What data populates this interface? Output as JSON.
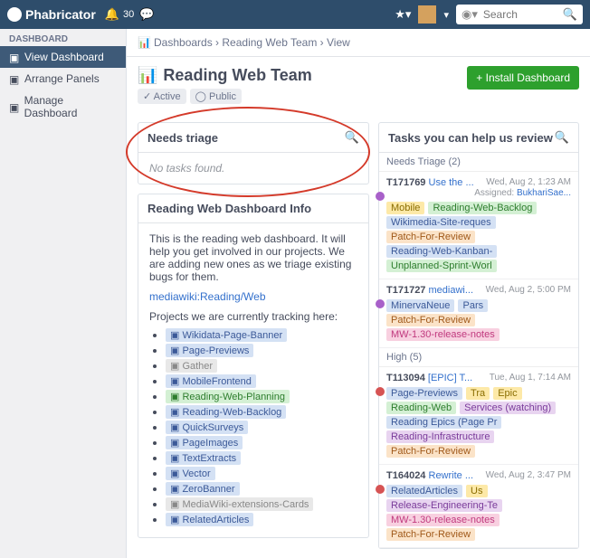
{
  "topbar": {
    "brand": "Phabricator",
    "notif_count": "30",
    "search_placeholder": "Search"
  },
  "sidebar": {
    "header": "DASHBOARD",
    "items": [
      {
        "label": "View Dashboard",
        "active": true
      },
      {
        "label": "Arrange Panels",
        "active": false
      },
      {
        "label": "Manage Dashboard",
        "active": false
      }
    ]
  },
  "breadcrumb": [
    "Dashboards",
    "Reading Web Team",
    "View"
  ],
  "page": {
    "title": "Reading Web Team",
    "tags": [
      "✓ Active",
      "◯ Public"
    ],
    "install_btn": "+ Install Dashboard"
  },
  "panel_triage": {
    "title": "Needs triage",
    "empty_text": "No tasks found."
  },
  "panel_info": {
    "title": "Reading Web Dashboard Info",
    "desc": "This is the reading web dashboard. It will help you get involved in our projects. We are adding new ones as we triage existing bugs for them.",
    "link": "mediawiki:Reading/Web",
    "tracking_label": "Projects we are currently tracking here:",
    "projects": [
      {
        "label": "Wikidata-Page-Banner",
        "cls": "bg-blue"
      },
      {
        "label": "Page-Previews",
        "cls": "bg-blue"
      },
      {
        "label": "Gather",
        "cls": "bg-grey"
      },
      {
        "label": "MobileFrontend",
        "cls": "bg-blue"
      },
      {
        "label": "Reading-Web-Planning",
        "cls": "bg-green"
      },
      {
        "label": "Reading-Web-Backlog",
        "cls": "bg-blue"
      },
      {
        "label": "QuickSurveys",
        "cls": "bg-blue"
      },
      {
        "label": "PageImages",
        "cls": "bg-blue"
      },
      {
        "label": "TextExtracts",
        "cls": "bg-blue"
      },
      {
        "label": "Vector",
        "cls": "bg-blue"
      },
      {
        "label": "ZeroBanner",
        "cls": "bg-blue"
      },
      {
        "label": "MediaWiki-extensions-Cards",
        "cls": "bg-grey"
      },
      {
        "label": "RelatedArticles",
        "cls": "bg-blue"
      }
    ]
  },
  "panel_review": {
    "title": "Tasks you can help us review",
    "sections": [
      {
        "label": "Needs Triage (2)",
        "tasks": [
          {
            "id": "T171769",
            "title": "Use the ...",
            "date": "Wed, Aug 2, 1:23 AM",
            "assigned": "BukhariSae...",
            "bullet": "purple",
            "tags": [
              {
                "label": "Mobile",
                "cls": "bg-yellow"
              },
              {
                "label": "Reading-Web-Backlog",
                "cls": "bg-green"
              },
              {
                "label": "Wikimedia-Site-reques",
                "cls": "bg-blue"
              },
              {
                "label": "Patch-For-Review",
                "cls": "bg-orange"
              },
              {
                "label": "Reading-Web-Kanban-",
                "cls": "bg-blue"
              },
              {
                "label": "Unplanned-Sprint-Worl",
                "cls": "bg-green"
              }
            ]
          },
          {
            "id": "T171727",
            "title": "mediawi...",
            "date": "Wed, Aug 2, 5:00 PM",
            "bullet": "purple",
            "tags": [
              {
                "label": "MinervaNeue",
                "cls": "bg-blue"
              },
              {
                "label": "Pars",
                "cls": "bg-blue"
              },
              {
                "label": "Patch-For-Review",
                "cls": "bg-orange"
              },
              {
                "label": "MW-1.30-release-notes",
                "cls": "bg-pink"
              }
            ]
          }
        ]
      },
      {
        "label": "High (5)",
        "tasks": [
          {
            "id": "T113094",
            "title": "[EPIC] T...",
            "date": "Tue, Aug 1, 7:14 AM",
            "bullet": "red",
            "tags": [
              {
                "label": "Page-Previews",
                "cls": "bg-blue"
              },
              {
                "label": "Tra",
                "cls": "bg-yellow"
              },
              {
                "label": "Epic",
                "cls": "bg-yellow"
              },
              {
                "label": "Reading-Web",
                "cls": "bg-green"
              },
              {
                "label": "Services (watching)",
                "cls": "bg-violet"
              },
              {
                "label": "Reading Epics (Page Pr",
                "cls": "bg-blue"
              },
              {
                "label": "Reading-Infrastructure",
                "cls": "bg-violet"
              },
              {
                "label": "Patch-For-Review",
                "cls": "bg-orange"
              }
            ]
          },
          {
            "id": "T164024",
            "title": "Rewrite ...",
            "date": "Wed, Aug 2, 3:47 PM",
            "bullet": "red",
            "tags": [
              {
                "label": "RelatedArticles",
                "cls": "bg-blue"
              },
              {
                "label": "Us",
                "cls": "bg-yellow"
              },
              {
                "label": "Release-Engineering-Te",
                "cls": "bg-violet"
              },
              {
                "label": "MW-1.30-release-notes",
                "cls": "bg-pink"
              },
              {
                "label": "Patch-For-Review",
                "cls": "bg-orange"
              }
            ]
          }
        ]
      }
    ]
  }
}
